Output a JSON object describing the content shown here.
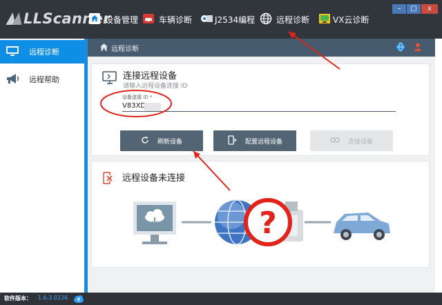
{
  "app": {
    "logo_text": "LLScanner"
  },
  "topnav": {
    "items": [
      {
        "label": "设备管理",
        "icon": "home-icon"
      },
      {
        "label": "车辆诊断",
        "icon": "car-icon"
      },
      {
        "label": "J2534编程",
        "icon": "j2534-icon"
      },
      {
        "label": "远程诊断",
        "icon": "globe-icon"
      },
      {
        "label": "VX云诊断",
        "icon": "vx-cloud-icon"
      }
    ]
  },
  "window_controls": {
    "minimize": "–",
    "maximize": "□",
    "close": "x"
  },
  "sidebar": {
    "items": [
      {
        "label": "远程诊断",
        "icon": "monitor-icon",
        "active": true
      },
      {
        "label": "远程帮助",
        "icon": "megaphone-icon",
        "active": false
      }
    ]
  },
  "content_header": {
    "title": "远程诊断"
  },
  "connect_panel": {
    "title": "连接远程设备",
    "subtitle": "请输入远程设备连接 ID",
    "field_label": "设备连接 ID *",
    "field_value": "V83XD",
    "buttons": {
      "refresh": "刷新设备",
      "config": "配置远程设备",
      "connect": "连接设备"
    }
  },
  "status_panel": {
    "title": "远程设备未连接",
    "question_mark": "?"
  },
  "statusbar": {
    "label": "软件版本：",
    "version": "1.6.3.0226"
  },
  "colors": {
    "titlebar": "#31363c",
    "accent": "#0e8ee4",
    "content_header": "#465b6d",
    "button": "#536575",
    "annotation": "#e0241b"
  }
}
